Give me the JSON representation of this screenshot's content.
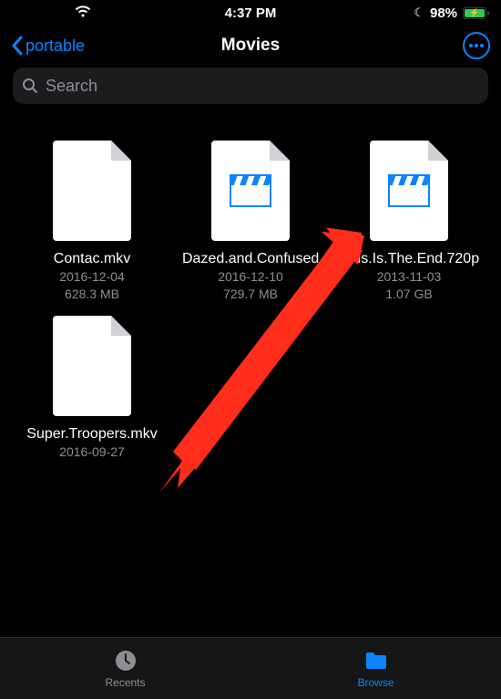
{
  "status": {
    "time": "4:37 PM",
    "battery_pct": "98%"
  },
  "nav": {
    "back_label": "portable",
    "title": "Movies"
  },
  "search": {
    "placeholder": "Search"
  },
  "files": [
    {
      "name": "Contac.mkv",
      "date": "2016-12-04",
      "size": "628.3 MB",
      "video": false
    },
    {
      "name": "Dazed.and.Confused",
      "date": "2016-12-10",
      "size": "729.7 MB",
      "video": true
    },
    {
      "name": "This.Is.The.End.720p",
      "date": "2013-11-03",
      "size": "1.07 GB",
      "video": true
    },
    {
      "name": "Super.Troopers.mkv",
      "date": "2016-09-27",
      "size": "",
      "video": false
    }
  ],
  "tabs": {
    "recents": "Recents",
    "browse": "Browse"
  }
}
